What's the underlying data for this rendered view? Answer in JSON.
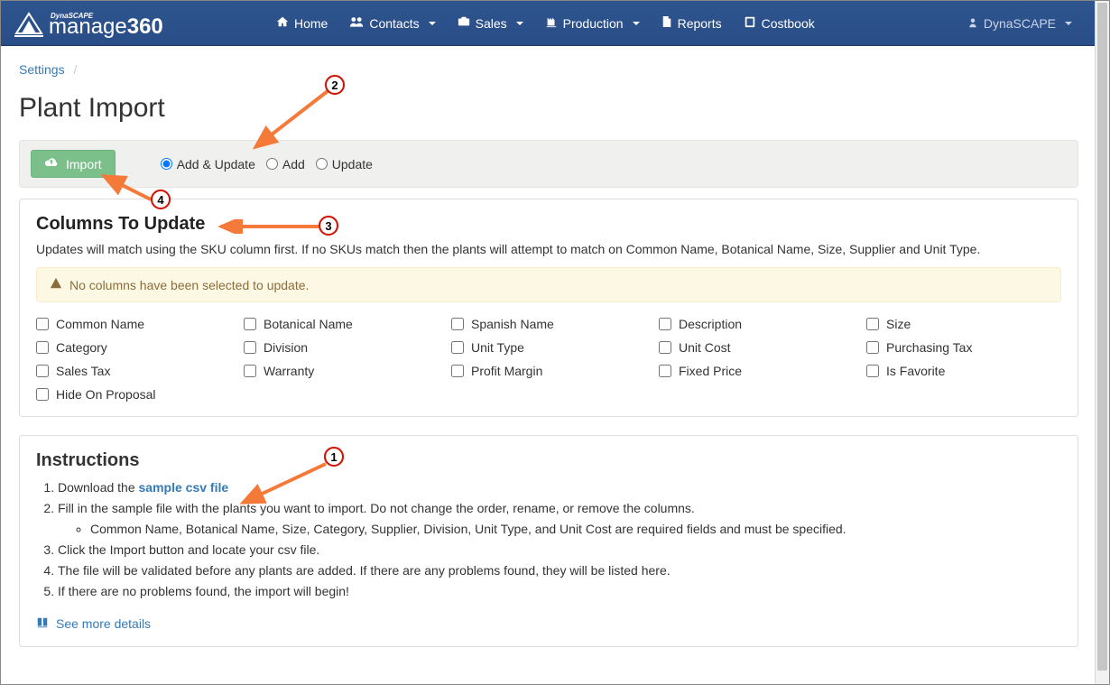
{
  "nav": {
    "brand_superscript": "DynaSCAPE",
    "brand_text": "manage360",
    "items": [
      {
        "label": "Home",
        "icon": "home-icon",
        "dropdown": false
      },
      {
        "label": "Contacts",
        "icon": "contacts-icon",
        "dropdown": true
      },
      {
        "label": "Sales",
        "icon": "sales-icon",
        "dropdown": true
      },
      {
        "label": "Production",
        "icon": "production-icon",
        "dropdown": true
      },
      {
        "label": "Reports",
        "icon": "reports-icon",
        "dropdown": false
      },
      {
        "label": "Costbook",
        "icon": "costbook-icon",
        "dropdown": false
      }
    ],
    "user_label": "DynaSCAPE"
  },
  "breadcrumb": {
    "settings": "Settings",
    "sep": "/"
  },
  "page_title": "Plant Import",
  "toolbar": {
    "import_label": "Import",
    "radios": [
      {
        "label": "Add & Update",
        "checked": true
      },
      {
        "label": "Add",
        "checked": false
      },
      {
        "label": "Update",
        "checked": false
      }
    ]
  },
  "columns_panel": {
    "title": "Columns To Update",
    "help": "Updates will match using the SKU column first. If no SKUs match then the plants will attempt to match on Common Name, Botanical Name, Size, Supplier and Unit Type.",
    "alert": "No columns have been selected to update.",
    "checkboxes": [
      "Common Name",
      "Botanical Name",
      "Spanish Name",
      "Description",
      "Size",
      "Category",
      "Division",
      "Unit Type",
      "Unit Cost",
      "Purchasing Tax",
      "Sales Tax",
      "Warranty",
      "Profit Margin",
      "Fixed Price",
      "Is Favorite",
      "Hide On Proposal"
    ]
  },
  "instructions_panel": {
    "title": "Instructions",
    "step1_prefix": "Download the ",
    "step1_link": "sample csv file",
    "step2": "Fill in the sample file with the plants you want to import. Do not change the order, rename, or remove the columns.",
    "step2_sub": "Common Name, Botanical Name, Size, Category, Supplier, Division, Unit Type, and Unit Cost are required fields and must be specified.",
    "step3": "Click the Import button and locate your csv file.",
    "step4": "The file will be validated before any plants are added. If there are any problems found, they will be listed here.",
    "step5": "If there are no problems found, the import will begin!",
    "more_details": "See more details"
  },
  "annotations": {
    "n1": "1",
    "n2": "2",
    "n3": "3",
    "n4": "4"
  }
}
